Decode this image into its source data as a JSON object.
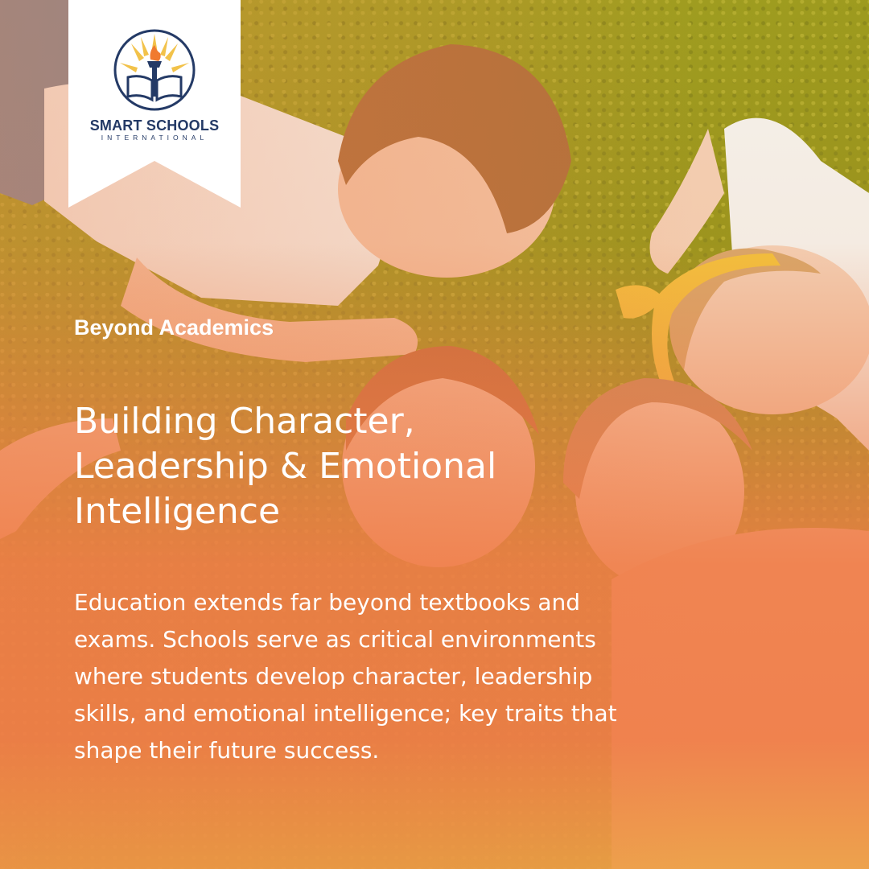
{
  "brand": {
    "name": "SMART SCHOOLS",
    "subtitle": "INTERNATIONAL",
    "logo_icon": "torch-book-icon",
    "navy": "#243a66",
    "sun": "#f2c24a",
    "flame": "#f07a30"
  },
  "eyebrow": "Beyond Academics",
  "headline": {
    "line1": "Building Character,",
    "line2": "Leadership & Emotional",
    "line3": "Intelligence"
  },
  "body": {
    "line1": "Education extends far beyond textbooks and",
    "line2": "exams. Schools serve as critical environments",
    "line3": "where students develop character, leadership",
    "line4": "skills, and emotional intelligence; key traits that",
    "line5": "shape their future success."
  },
  "colors": {
    "overlay": "#ef7d48",
    "carpet": "#9c9a1e",
    "text": "#ffffff"
  }
}
